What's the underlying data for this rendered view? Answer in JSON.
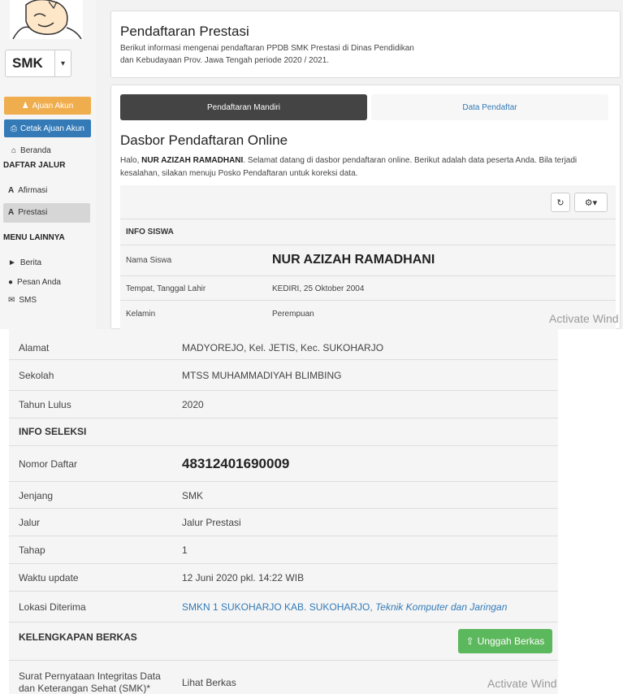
{
  "sidebar": {
    "school_type": "SMK",
    "btn_ajuan": "Ajuan Akun",
    "btn_cetak": "Cetak Ajuan Akun",
    "beranda": "Beranda",
    "daftar_jalur": "DAFTAR JALUR",
    "afirmasi": "Afirmasi",
    "prestasi": "Prestasi",
    "menu_lainnya": "MENU LAINNYA",
    "berita": "Berita",
    "pesan": "Pesan Anda",
    "sms": "SMS"
  },
  "header": {
    "title": "Pendaftaran Prestasi",
    "desc_line1": "Berikut informasi mengenai pendaftaran PPDB SMK Prestasi di Dinas Pendidikan",
    "desc_line2": "dan Kebudayaan Prov. Jawa Tengah periode 2020 / 2021."
  },
  "tabs": {
    "active": "Pendaftaran Mandiri",
    "other": "Data Pendaftar"
  },
  "dashboard": {
    "title": "Dasbor Pendaftaran Online",
    "greet_prefix": "Halo, ",
    "greet_name": "NUR AZIZAH RAMADHANI",
    "greet_rest1": ". Selamat datang di dasbor pendaftaran online. Berikut adalah data peserta Anda. Bila terjadi",
    "greet_line2": "kesalahan, silakan menuju Posko Pendaftaran untuk koreksi data."
  },
  "info_siswa": {
    "heading": "INFO SISWA",
    "nama_label": "Nama Siswa",
    "nama_value": "NUR AZIZAH RAMADHANI",
    "ttl_label": "Tempat, Tanggal Lahir",
    "ttl_value": "KEDIRI, 25 Oktober 2004",
    "kelamin_label": "Kelamin",
    "kelamin_value": "Perempuan",
    "alamat_label": "Alamat",
    "alamat_value": "MADYOREJO, Kel. JETIS, Kec. SUKOHARJO",
    "sekolah_label": "Sekolah",
    "sekolah_value": "MTSS MUHAMMADIYAH BLIMBING",
    "lulus_label": "Tahun Lulus",
    "lulus_value": "2020"
  },
  "info_seleksi": {
    "heading": "INFO SELEKSI",
    "nomor_label": "Nomor Daftar",
    "nomor_value": "48312401690009",
    "jenjang_label": "Jenjang",
    "jenjang_value": "SMK",
    "jalur_label": "Jalur",
    "jalur_value": "Jalur Prestasi",
    "tahap_label": "Tahap",
    "tahap_value": "1",
    "waktu_label": "Waktu update",
    "waktu_value": "12 Juni 2020 pkl. 14:22 WIB",
    "lokasi_label": "Lokasi Diterima",
    "lokasi_school": "SMKN 1 SUKOHARJO KAB. SUKOHARJO, ",
    "lokasi_program": "Teknik Komputer dan Jaringan"
  },
  "berkas": {
    "heading": "KELENGKAPAN BERKAS",
    "upload_label": "Unggah Berkas",
    "surat_line1": "Surat Pernyataan Integritas Data",
    "surat_line2": "dan Keterangan Sehat (SMK)*",
    "lihat_label": "Lihat Berkas"
  },
  "watermark": "Activate Wind",
  "watermark2": "Activate Wind"
}
